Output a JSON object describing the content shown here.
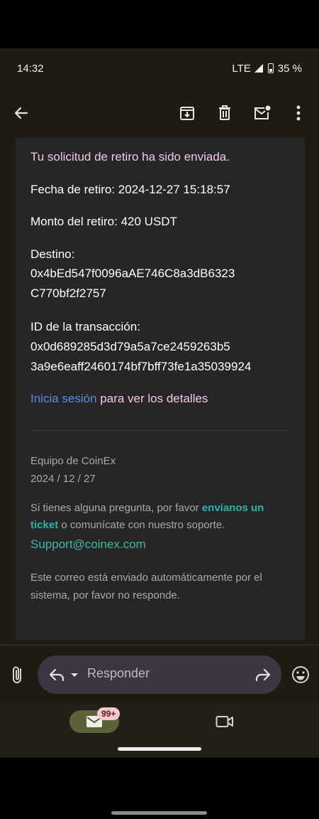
{
  "status_bar": {
    "time": "14:32",
    "network": "LTE",
    "battery": "35 %"
  },
  "toolbar": {
    "back_icon": "arrow-left",
    "archive_icon": "archive-down",
    "delete_icon": "trash",
    "mark_unread_icon": "mail-dot",
    "more_icon": "vertical-dots"
  },
  "email": {
    "headline": "Tu solicitud de retiro ha sido enviada.",
    "date_label": "Fecha de retiro:",
    "date_value": "2024-12-27 15:18:57",
    "amount_label": "Monto del retiro:",
    "amount_value": "420 USDT",
    "destination_label": "Destino:",
    "destination_line1": "0x4bEd547f0096aAE746C8a3dB6323",
    "destination_line2": "C770bf2f2757",
    "txid_label": "ID de la transacción:",
    "txid_line1": "0x0d689285d3d79a5a7ce2459263b5",
    "txid_line2": "3a9e6eaff2460174bf7bff73fe1a35039924",
    "login_link": "Inicia sesión",
    "login_suffix": " para ver los detalles",
    "team": "Equipo de CoinEx",
    "signature_date": "2024 / 12 / 27",
    "question_prefix": "Si tienes alguna pregunta, por favor ",
    "ticket_link_part1": "envíanos un",
    "ticket_link_part2": "ticket",
    "question_suffix": " o comunícate con nuestro soporte.",
    "support_email": "Support@coinex.com",
    "auto_notice_line1": "Este correo está enviado automáticamente por el",
    "auto_notice_line2": "sistema, por favor no responde."
  },
  "compose": {
    "reply_placeholder": "Responder"
  },
  "bottom_nav": {
    "mail_badge": "99+"
  },
  "colors": {
    "link_blue": "#5a8fe8",
    "link_teal": "#3fb8a4",
    "headline_pink": "#f5c6ec"
  }
}
